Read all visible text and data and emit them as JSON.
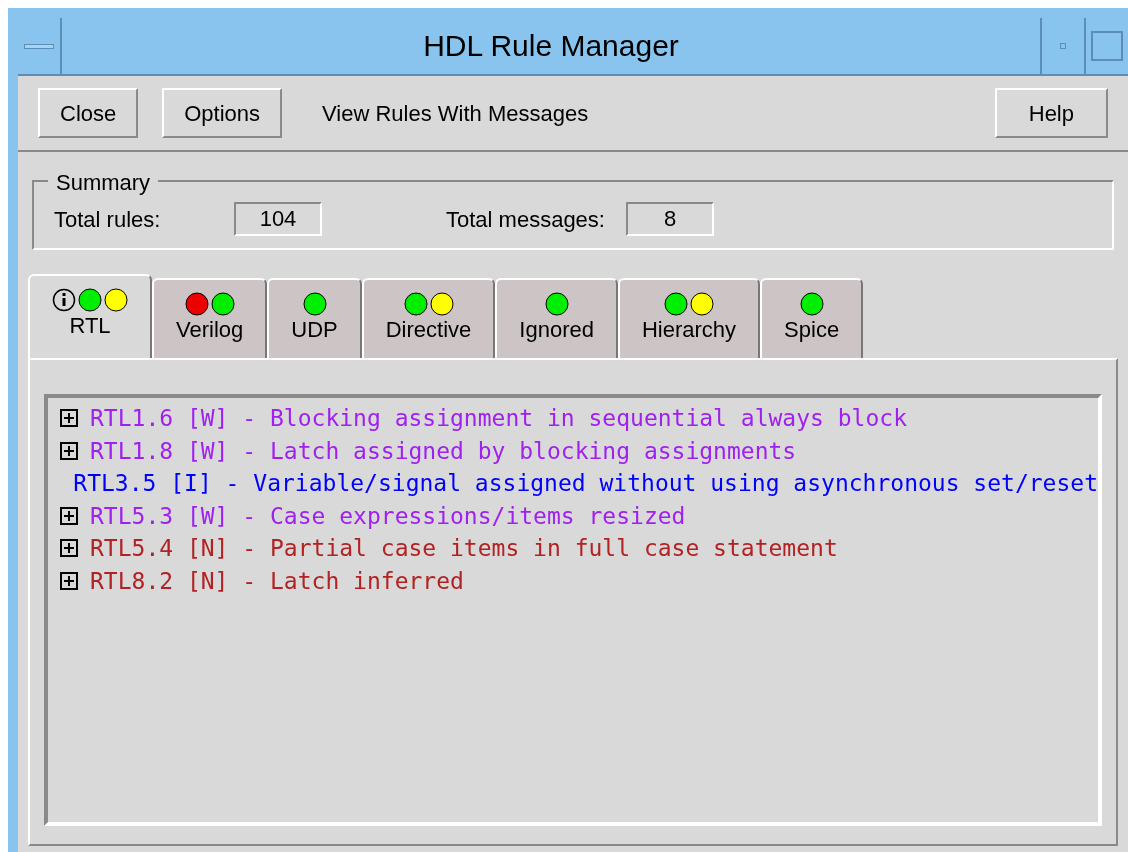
{
  "window": {
    "title": "HDL Rule Manager"
  },
  "toolbar": {
    "buttons_left": [
      "Close",
      "Options"
    ],
    "view_label": "View Rules With Messages",
    "buttons_right": [
      "Help"
    ]
  },
  "summary": {
    "title": "Summary",
    "fields": [
      {
        "label": "Total rules:",
        "value": "104"
      },
      {
        "label": "Total messages:",
        "value": "8"
      }
    ]
  },
  "tabs": [
    {
      "label": "RTL",
      "selected": true,
      "indicators": [
        {
          "kind": "info"
        },
        {
          "kind": "dot",
          "color": "#00ee00"
        },
        {
          "kind": "dot",
          "color": "#ffff00"
        }
      ]
    },
    {
      "label": "Verilog",
      "selected": false,
      "indicators": [
        {
          "kind": "dot",
          "color": "#ee0000"
        },
        {
          "kind": "dot",
          "color": "#00ee00"
        }
      ]
    },
    {
      "label": "UDP",
      "selected": false,
      "indicators": [
        {
          "kind": "dot",
          "color": "#00ee00"
        }
      ]
    },
    {
      "label": "Directive",
      "selected": false,
      "indicators": [
        {
          "kind": "dot",
          "color": "#00ee00"
        },
        {
          "kind": "dot",
          "color": "#ffff00"
        }
      ]
    },
    {
      "label": "Ignored",
      "selected": false,
      "indicators": [
        {
          "kind": "dot",
          "color": "#00ee00"
        }
      ]
    },
    {
      "label": "Hierarchy",
      "selected": false,
      "indicators": [
        {
          "kind": "dot",
          "color": "#00ee00"
        },
        {
          "kind": "dot",
          "color": "#ffff00"
        }
      ]
    },
    {
      "label": "Spice",
      "selected": false,
      "indicators": [
        {
          "kind": "dot",
          "color": "#00ee00"
        }
      ]
    }
  ],
  "rules": [
    {
      "text": "RTL1.6 [W] - Blocking assignment in sequential always block",
      "expandable": true,
      "color": "#a020f0"
    },
    {
      "text": "RTL1.8 [W] - Latch assigned by blocking assignments",
      "expandable": true,
      "color": "#a020f0"
    },
    {
      "text": "RTL3.5 [I] - Variable/signal assigned without using asynchronous set/reset",
      "expandable": false,
      "color": "#0000ff"
    },
    {
      "text": "RTL5.3 [W] - Case expressions/items resized",
      "expandable": true,
      "color": "#a020f0"
    },
    {
      "text": "RTL5.4 [N] - Partial case items in full case statement",
      "expandable": true,
      "color": "#b22222"
    },
    {
      "text": "RTL8.2 [N] - Latch inferred",
      "expandable": true,
      "color": "#b22222"
    }
  ]
}
